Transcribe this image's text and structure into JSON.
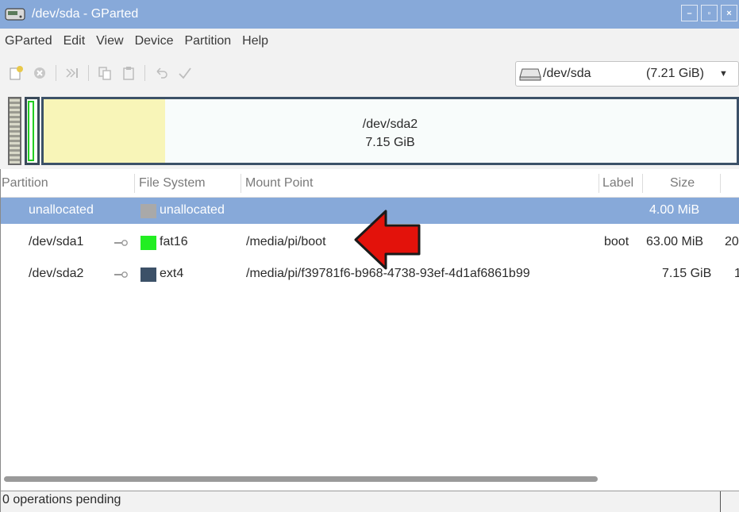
{
  "window": {
    "title": "/dev/sda - GParted",
    "buttons": {
      "minimize": "–",
      "maximize": "▫",
      "close": "×"
    }
  },
  "menu": [
    "GParted",
    "Edit",
    "View",
    "Device",
    "Partition",
    "Help"
  ],
  "toolbar": {
    "icons": [
      "new-icon",
      "delete-icon",
      "resize-move-icon",
      "copy-icon",
      "paste-icon",
      "undo-icon",
      "apply-icon"
    ],
    "device_name": "/dev/sda",
    "device_size": "(7.21 GiB)"
  },
  "map": {
    "partition_name": "/dev/sda2",
    "partition_size": "7.15 GiB",
    "used_fraction": 0.175
  },
  "table": {
    "headers": [
      "Partition",
      "File System",
      "Mount Point",
      "Label",
      "Size"
    ],
    "rows": [
      {
        "partition": "unallocated",
        "fs": "unallocated",
        "mount": "",
        "label": "",
        "size": "4.00 MiB",
        "extra": "",
        "fs_color": "#a9a9a9",
        "selected": true,
        "mounted": false
      },
      {
        "partition": "/dev/sda1",
        "fs": "fat16",
        "mount": "/media/pi/boot",
        "label": "boot",
        "size": "63.00 MiB",
        "extra": "20",
        "fs_color": "#22ee22",
        "selected": false,
        "mounted": true
      },
      {
        "partition": "/dev/sda2",
        "fs": "ext4",
        "mount": "/media/pi/f39781f6-b968-4738-93ef-4d1af6861b99",
        "label": "",
        "size": "7.15 GiB",
        "extra": "1",
        "fs_color": "#3c5168",
        "selected": false,
        "mounted": true
      }
    ]
  },
  "status": {
    "text": "0 operations pending"
  },
  "colors": {
    "accent": "#87a9d9",
    "arrow": "#e3120b"
  }
}
